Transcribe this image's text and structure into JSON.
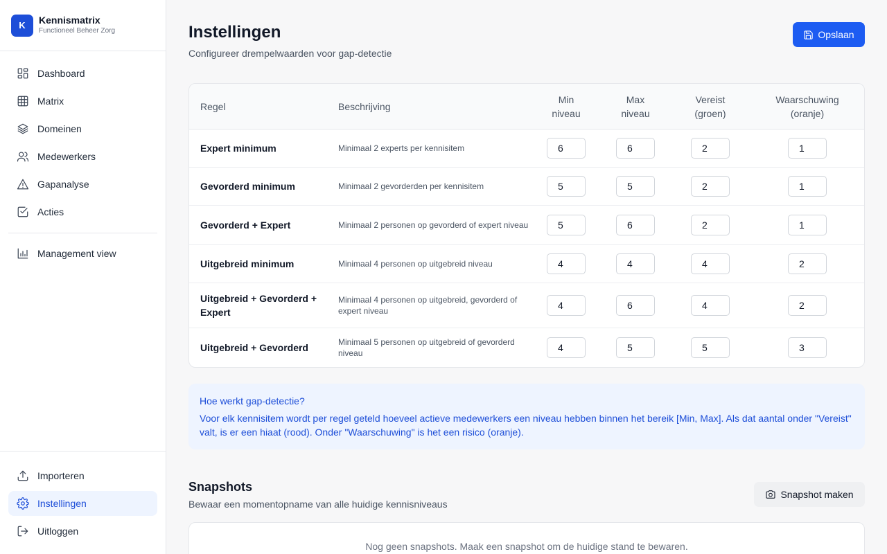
{
  "app": {
    "name": "Kennismatrix",
    "subtitle": "Functioneel Beheer Zorg",
    "logo_letter": "K",
    "accent_color": "#1d4ed8"
  },
  "sidebar": {
    "items": [
      {
        "label": "Dashboard",
        "icon": "dashboard-icon"
      },
      {
        "label": "Matrix",
        "icon": "grid-icon"
      },
      {
        "label": "Domeinen",
        "icon": "layers-icon"
      },
      {
        "label": "Medewerkers",
        "icon": "users-icon"
      },
      {
        "label": "Gapanalyse",
        "icon": "warning-icon"
      },
      {
        "label": "Acties",
        "icon": "check-square-icon"
      }
    ],
    "secondary_items": [
      {
        "label": "Management view",
        "icon": "bar-chart-icon"
      }
    ],
    "bottom_items": [
      {
        "label": "Importeren",
        "icon": "upload-icon"
      },
      {
        "label": "Instellingen",
        "icon": "gear-icon",
        "active": true
      },
      {
        "label": "Uitloggen",
        "icon": "logout-icon"
      }
    ]
  },
  "header": {
    "title": "Instellingen",
    "subtitle": "Configureer drempelwaarden voor gap-detectie",
    "save_label": "Opslaan"
  },
  "table": {
    "headers": {
      "regel": "Regel",
      "beschrijving": "Beschrijving",
      "min_line1": "Min",
      "min_line2": "niveau",
      "max_line1": "Max",
      "max_line2": "niveau",
      "vereist_line1": "Vereist",
      "vereist_line2": "(groen)",
      "waarschuwing_line1": "Waarschuwing",
      "waarschuwing_line2": "(oranje)"
    },
    "rows": [
      {
        "regel": "Expert minimum",
        "beschrijving": "Minimaal 2 experts per kennisitem",
        "min": "6",
        "max": "6",
        "vereist": "2",
        "waarschuwing": "1"
      },
      {
        "regel": "Gevorderd minimum",
        "beschrijving": "Minimaal 2 gevorderden per kennisitem",
        "min": "5",
        "max": "5",
        "vereist": "2",
        "waarschuwing": "1"
      },
      {
        "regel": "Gevorderd + Expert",
        "beschrijving": "Minimaal 2 personen op gevorderd of expert niveau",
        "min": "5",
        "max": "6",
        "vereist": "2",
        "waarschuwing": "1"
      },
      {
        "regel": "Uitgebreid minimum",
        "beschrijving": "Minimaal 4 personen op uitgebreid niveau",
        "min": "4",
        "max": "4",
        "vereist": "4",
        "waarschuwing": "2"
      },
      {
        "regel": "Uitgebreid + Gevorderd + Expert",
        "beschrijving": "Minimaal 4 personen op uitgebreid, gevorderd of expert niveau",
        "min": "4",
        "max": "6",
        "vereist": "4",
        "waarschuwing": "2"
      },
      {
        "regel": "Uitgebreid + Gevorderd",
        "beschrijving": "Minimaal 5 personen op uitgebreid of gevorderd niveau",
        "min": "4",
        "max": "5",
        "vereist": "5",
        "waarschuwing": "3"
      }
    ]
  },
  "info": {
    "title": "Hoe werkt gap-detectie?",
    "text": "Voor elk kennisitem wordt per regel geteld hoeveel actieve medewerkers een niveau hebben binnen het bereik [Min, Max]. Als dat aantal onder \"Vereist\" valt, is er een hiaat (rood). Onder \"Waarschuwing\" is het een risico (oranje)."
  },
  "snapshots": {
    "title": "Snapshots",
    "subtitle": "Bewaar een momentopname van alle huidige kennisniveaus",
    "button_label": "Snapshot maken",
    "empty_text": "Nog geen snapshots. Maak een snapshot om de huidige stand te bewaren."
  }
}
